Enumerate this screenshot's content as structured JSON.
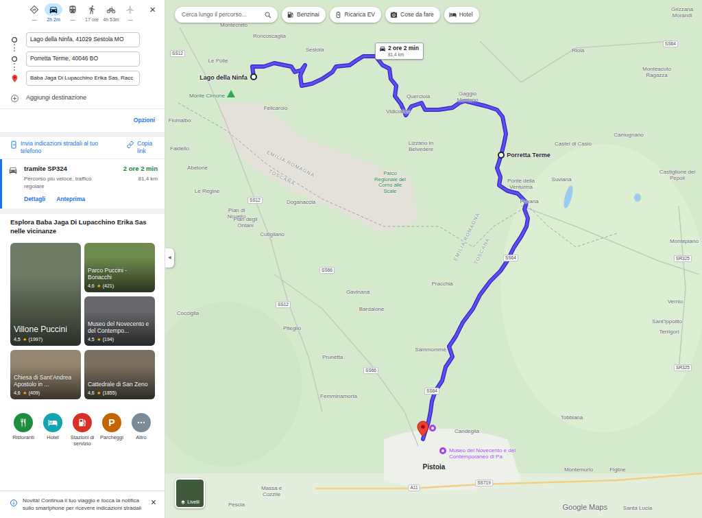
{
  "modes": [
    {
      "kind": "best",
      "label": "—",
      "selected": false,
      "disabled": false
    },
    {
      "kind": "car",
      "label": "2h 2m",
      "selected": true,
      "disabled": false
    },
    {
      "kind": "transit",
      "label": "—",
      "selected": false,
      "disabled": false
    },
    {
      "kind": "walk",
      "label": "17 ore",
      "selected": false,
      "disabled": false
    },
    {
      "kind": "bike",
      "label": "4h 53m",
      "selected": false,
      "disabled": false
    },
    {
      "kind": "flight",
      "label": "—",
      "selected": false,
      "disabled": true
    }
  ],
  "close": "×",
  "waypoints": [
    {
      "kind": "origin",
      "value": "Lago della Ninfa, 41029 Sestola MO"
    },
    {
      "kind": "stop",
      "value": "Porretta Terme, 40046 BO"
    },
    {
      "kind": "destination",
      "value": "Baba Jaga Di Lupacchino Erika Sas, Racc"
    }
  ],
  "add_destination": "Aggiungi destinazione",
  "options": "Opzioni",
  "share": {
    "send": "Invia indicazioni stradali al tuo telefono",
    "copy": "Copia link"
  },
  "routes": [
    {
      "via": "tramite SP324",
      "duration": "2 ore 2 min",
      "summary": "Percorso più veloce, traffico regolare",
      "distance": "81,4 km",
      "selected": true,
      "actions": [
        "Dettagli",
        "Anteprima"
      ]
    }
  ],
  "explore": {
    "title": "Esplora Baba Jaga Di Lupacchino Erika Sas nelle vicinanze",
    "places": [
      {
        "name": "Villone Puccini",
        "rating": "4,5",
        "star": "★",
        "reviews": "(1997)"
      },
      {
        "name": "Parco Puccini - Bonacchi",
        "rating": "4,6",
        "star": "★",
        "reviews": "(421)"
      },
      {
        "name": "Museo del Novecento e del Contempo...",
        "rating": "4,5",
        "star": "★",
        "reviews": "(194)"
      },
      {
        "name": "Chiesa di Sant'Andrea Apostolo in ...",
        "rating": "4,6",
        "star": "★",
        "reviews": "(409)"
      },
      {
        "name": "Cattedrale di San Zeno",
        "rating": "4,6",
        "star": "★",
        "reviews": "(1855)"
      }
    ]
  },
  "categories": [
    {
      "kind": "restaurant",
      "label": "Ristoranti",
      "color": "#1e8e3e"
    },
    {
      "kind": "hotel",
      "label": "Hotel",
      "color": "#12a4af"
    },
    {
      "kind": "fuel",
      "label": "Stazioni di servizio",
      "color": "#d93025"
    },
    {
      "kind": "parking",
      "label": "Parcheggi",
      "color": "#c26401",
      "glyph": "P"
    },
    {
      "kind": "more",
      "label": "Altro",
      "color": "#7c8b98"
    }
  ],
  "notice": {
    "text": "Novità! Continua il tuo viaggio e tocca la notifica sullo smartphone per ricevere indicazioni stradali",
    "close": "×"
  },
  "map": {
    "search": {
      "placeholder": "Cerca lungo il percorso..."
    },
    "chips": [
      {
        "kind": "fuel",
        "label": "Benzinai"
      },
      {
        "kind": "ev",
        "label": "Ricarica EV"
      },
      {
        "kind": "things",
        "label": "Cose da fare"
      },
      {
        "kind": "hotel",
        "label": "Hotel"
      }
    ],
    "route_label": {
      "duration": "2 ore 2 min",
      "distance": "81,4 km"
    },
    "places": [
      {
        "name": "Montecreto",
        "kind": "town"
      },
      {
        "name": "Roncoscaglia",
        "kind": "town"
      },
      {
        "name": "Sestola",
        "kind": "town"
      },
      {
        "name": "Le Polle",
        "kind": "town"
      },
      {
        "name": "Lago della Ninfa",
        "kind": "endpoint"
      },
      {
        "name": "Monte Cimone",
        "kind": "peak"
      },
      {
        "name": "Felicarolo",
        "kind": "town"
      },
      {
        "name": "Fiumalbo",
        "kind": "town"
      },
      {
        "name": "Faidello",
        "kind": "town"
      },
      {
        "name": "Abetone",
        "kind": "town"
      },
      {
        "name": "Le Regine",
        "kind": "town"
      },
      {
        "name": "Pian di Novello",
        "kind": "town"
      },
      {
        "name": "Pian degli Ontani",
        "kind": "town"
      },
      {
        "name": "Cutigliano",
        "kind": "town"
      },
      {
        "name": "Doganaccia",
        "kind": "town"
      },
      {
        "name": "Vidiciatico",
        "kind": "town"
      },
      {
        "name": "Querciola",
        "kind": "town"
      },
      {
        "name": "Gaggio Montano",
        "kind": "town"
      },
      {
        "name": "Lizzano In Belvedere",
        "kind": "town"
      },
      {
        "name": "Parco Regionale del Corno alle Scale",
        "kind": "park"
      },
      {
        "name": "Porretta Terme",
        "kind": "endpoint"
      },
      {
        "name": "Ponte della Venturina",
        "kind": "town"
      },
      {
        "name": "Pavana",
        "kind": "town"
      },
      {
        "name": "Castel di Casio",
        "kind": "town"
      },
      {
        "name": "Suviana",
        "kind": "town"
      },
      {
        "name": "Camugnano",
        "kind": "town"
      },
      {
        "name": "Riola",
        "kind": "town"
      },
      {
        "name": "Grizzana Morandi",
        "kind": "town"
      },
      {
        "name": "Monteacuto Ragazza",
        "kind": "town"
      },
      {
        "name": "Castiglione dei Pepoli",
        "kind": "town"
      },
      {
        "name": "Montepiano",
        "kind": "town"
      },
      {
        "name": "Vernio",
        "kind": "town"
      },
      {
        "name": "Sant'Ippolito",
        "kind": "town"
      },
      {
        "name": "Terrigori",
        "kind": "town"
      },
      {
        "name": "Pracchia",
        "kind": "town"
      },
      {
        "name": "Gavinana",
        "kind": "town"
      },
      {
        "name": "Bardalone",
        "kind": "town"
      },
      {
        "name": "Sammommè",
        "kind": "town"
      },
      {
        "name": "Piteglio",
        "kind": "town"
      },
      {
        "name": "Prunetta",
        "kind": "town"
      },
      {
        "name": "Cocciglia",
        "kind": "town"
      },
      {
        "name": "Femminamorta",
        "kind": "town"
      },
      {
        "name": "Candeglia",
        "kind": "town"
      },
      {
        "name": "Tobbiana",
        "kind": "town"
      },
      {
        "name": "Montemurlo",
        "kind": "town"
      },
      {
        "name": "Figline",
        "kind": "town"
      },
      {
        "name": "Pistoia",
        "kind": "city"
      },
      {
        "name": "Museo del Novecento e del Contemporaneo di Pa",
        "kind": "museum"
      },
      {
        "name": "Massa e Cozzile",
        "kind": "town"
      },
      {
        "name": "Pescia",
        "kind": "town"
      },
      {
        "name": "Santa Lucia",
        "kind": "town"
      },
      {
        "name": "EMILIA ROMAGNA",
        "kind": "region"
      },
      {
        "name": "TOSCANA",
        "kind": "region"
      },
      {
        "name": "EMILIA ROMAGNA",
        "kind": "region"
      },
      {
        "name": "TOSCANA",
        "kind": "region"
      },
      {
        "name": "SS12",
        "kind": "road"
      },
      {
        "name": "SS64",
        "kind": "road"
      },
      {
        "name": "SS12",
        "kind": "road"
      },
      {
        "name": "SS12",
        "kind": "road"
      },
      {
        "name": "SS66",
        "kind": "road"
      },
      {
        "name": "SS66",
        "kind": "road"
      },
      {
        "name": "SS64",
        "kind": "road"
      },
      {
        "name": "SS64",
        "kind": "road"
      },
      {
        "name": "SR325",
        "kind": "road"
      },
      {
        "name": "SR325",
        "kind": "road"
      },
      {
        "name": "A11",
        "kind": "road"
      },
      {
        "name": "SS719",
        "kind": "road"
      }
    ],
    "collapse": "◀",
    "layers": "Livelli",
    "logo": "Google Maps"
  }
}
